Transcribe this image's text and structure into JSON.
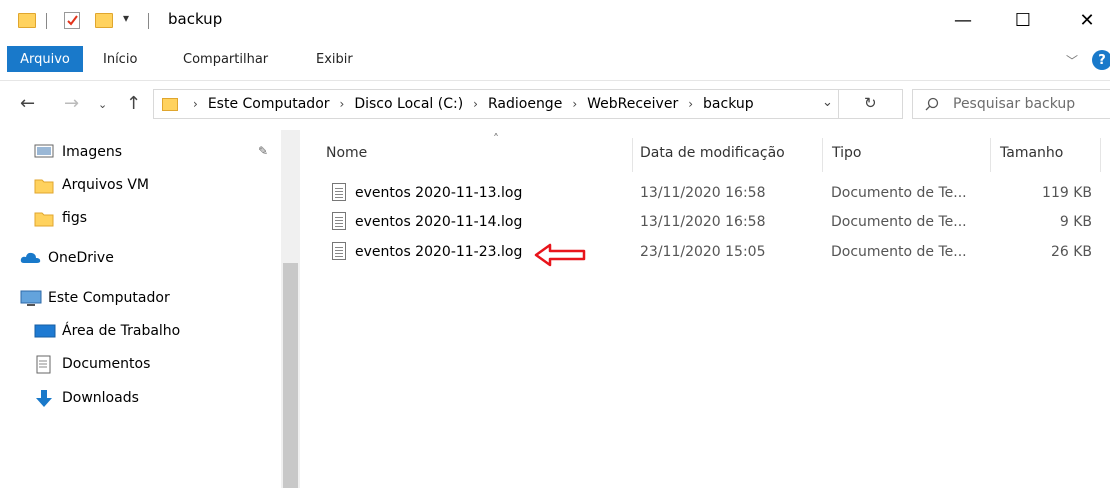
{
  "window": {
    "title": "backup",
    "controls": {
      "minimize": "—",
      "maximize": "☐",
      "close": "✕"
    }
  },
  "ribbon": {
    "tabs": [
      "Arquivo",
      "Início",
      "Compartilhar",
      "Exibir"
    ],
    "active_tab": "Arquivo",
    "accent": "#1979ca"
  },
  "address": {
    "crumbs": [
      "Este Computador",
      "Disco Local (C:)",
      "Radioenge",
      "WebReceiver",
      "backup"
    ],
    "search_placeholder": "Pesquisar backup"
  },
  "nav": {
    "items": [
      {
        "label": "Imagens",
        "icon": "pictures-icon"
      },
      {
        "label": "Arquivos VM",
        "icon": "folder-icon"
      },
      {
        "label": "figs",
        "icon": "folder-icon"
      },
      {
        "label": "OneDrive",
        "icon": "cloud-icon"
      },
      {
        "label": "Este Computador",
        "icon": "computer-icon"
      },
      {
        "label": "Área de Trabalho",
        "icon": "desktop-icon"
      },
      {
        "label": "Documentos",
        "icon": "documents-icon"
      },
      {
        "label": "Downloads",
        "icon": "download-icon"
      }
    ]
  },
  "table": {
    "columns": [
      "Nome",
      "Data de modificação",
      "Tipo",
      "Tamanho"
    ],
    "rows": [
      {
        "name": "eventos 2020-11-13.log",
        "date": "13/11/2020 16:58",
        "type": "Documento de Te...",
        "size": "119 KB"
      },
      {
        "name": "eventos 2020-11-14.log",
        "date": "13/11/2020 16:58",
        "type": "Documento de Te...",
        "size": "9 KB"
      },
      {
        "name": "eventos 2020-11-23.log",
        "date": "23/11/2020 15:05",
        "type": "Documento de Te...",
        "size": "26 KB"
      }
    ],
    "annotation_color": "#e8141b"
  }
}
